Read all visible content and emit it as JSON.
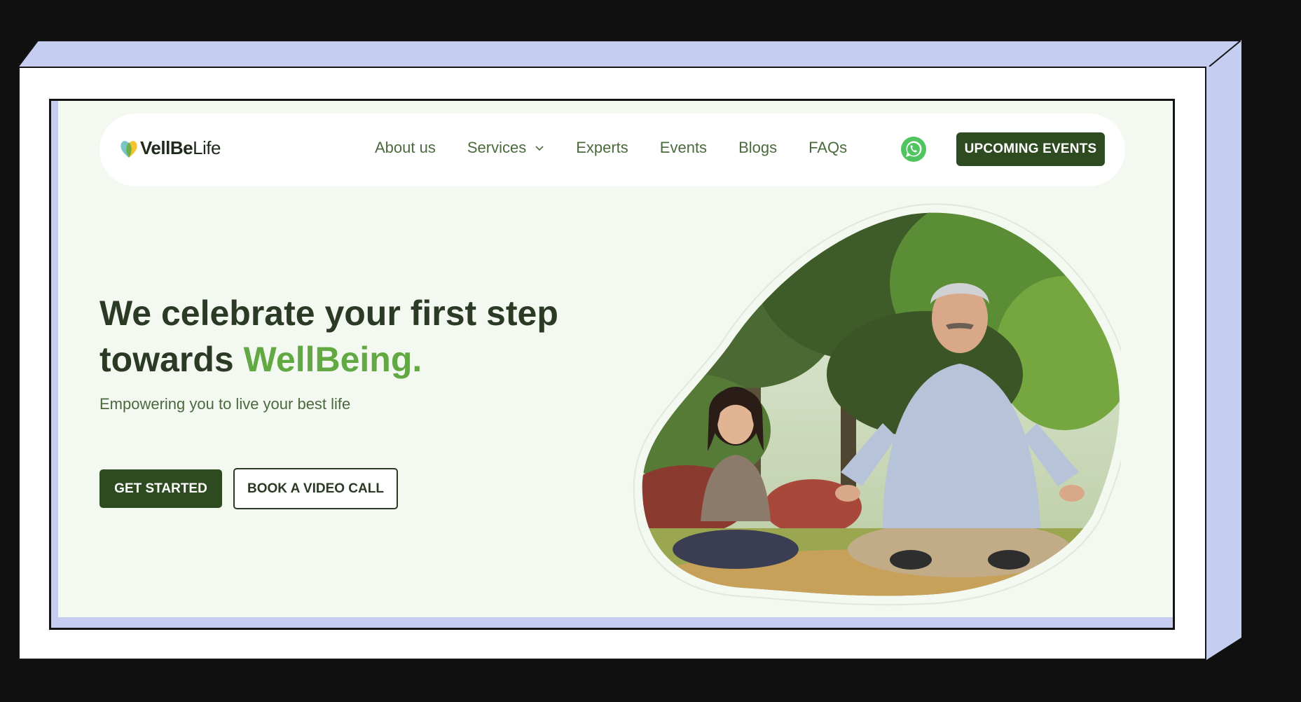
{
  "brand": {
    "name_bold": "VellBe",
    "name_light": "Life"
  },
  "nav": {
    "items": [
      {
        "label": "About us"
      },
      {
        "label": "Services"
      },
      {
        "label": "Experts"
      },
      {
        "label": "Events"
      },
      {
        "label": "Blogs"
      },
      {
        "label": "FAQs"
      }
    ],
    "cta_label": "UPCOMING EVENTS"
  },
  "hero": {
    "title_line1": "We celebrate your first step",
    "title_line2_prefix": "towards ",
    "title_accent": "WellBeing.",
    "subtitle": "Empowering you to live your best life",
    "primary_button": "GET STARTED",
    "secondary_button": "BOOK A VIDEO CALL"
  },
  "icons": {
    "whatsapp": "whatsapp-icon",
    "services_dropdown": "chevron-down-icon",
    "logo": "heart-leaf-logo-icon"
  },
  "colors": {
    "primary_dark": "#2d4a20",
    "accent_green": "#62a843",
    "text_dark": "#2b3a24",
    "nav_text": "#4a6a3d",
    "page_bg": "#f3f8f1",
    "frame_lavender": "#c5cef0"
  }
}
